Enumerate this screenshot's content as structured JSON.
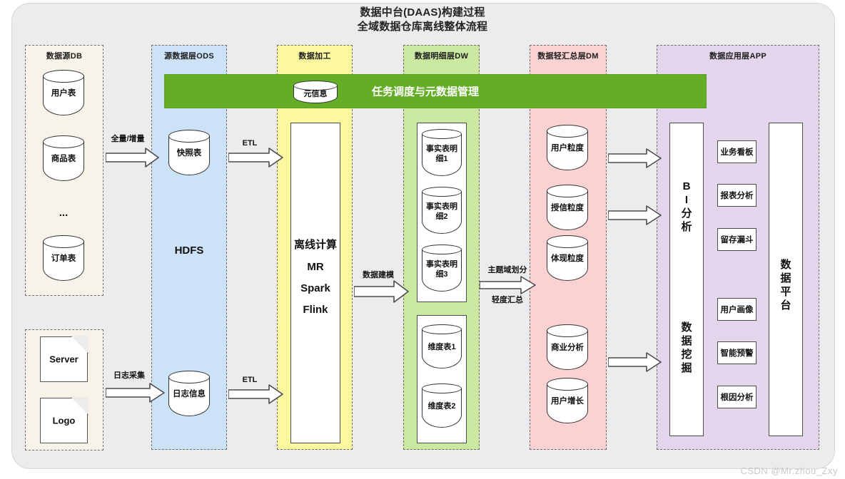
{
  "title": {
    "line1": "数据中台(DAAS)构建过程",
    "line2": "全域数据仓库离线整体流程"
  },
  "watermark": "CSDN @Mr.zhou_Zxy",
  "lanes": [
    {
      "id": "db",
      "label": "数据源DB",
      "color": "#f7f3e8"
    },
    {
      "id": "ods",
      "label": "源数据层ODS",
      "color": "#cce2f7"
    },
    {
      "id": "etl",
      "label": "数据加工",
      "color": "#fbf8a0"
    },
    {
      "id": "dw",
      "label": "数据明细层DW",
      "color": "#cbe8a0"
    },
    {
      "id": "dm",
      "label": "数据轻汇总层DM",
      "color": "#fbd2d2"
    },
    {
      "id": "app",
      "label": "数据应用层APP",
      "color": "#e2d5ec"
    }
  ],
  "green_band": {
    "cylinder_label": "元信息",
    "band_label": "任务调度与元数据管理",
    "color": "#64ad27"
  },
  "source_db": {
    "tables": [
      "用户表",
      "商品表",
      "订单表"
    ],
    "ellipsis": "..."
  },
  "log_sources": {
    "docs": [
      "Server",
      "Logo"
    ]
  },
  "ods": {
    "snapshot_table": "快照表",
    "log_info_table": "日志信息",
    "storage_label": "HDFS"
  },
  "processing": {
    "heading": "离线计算",
    "engines": [
      "MR",
      "Spark",
      "Flink"
    ]
  },
  "dw": {
    "fact_tables": [
      "事实表明\n细1",
      "事实表明\n细2",
      "事实表明\n细3"
    ],
    "dim_tables": [
      "维度表1",
      "维度表2"
    ]
  },
  "dm": {
    "granularity": [
      "用户粒度",
      "授信粒度",
      "体现粒度"
    ],
    "analysis": [
      "商业分析",
      "用户增长"
    ]
  },
  "app": {
    "left_column": [
      "BI\n分\n析",
      "数\n据\n挖\n掘"
    ],
    "bi_label": [
      "B",
      "I",
      "分",
      "析"
    ],
    "mining_label": [
      "数",
      "据",
      "挖",
      "掘"
    ],
    "platform_label": [
      "数",
      "据",
      "平",
      "台"
    ],
    "cards_top": [
      "业务看板",
      "报表分析",
      "留存漏斗"
    ],
    "cards_bottom": [
      "用户画像",
      "智能预警",
      "根因分析"
    ]
  },
  "arrows": {
    "full_incremental": "全量/增量",
    "log_collect": "日志采集",
    "etl_top": "ETL",
    "etl_bottom": "ETL",
    "data_modeling": "数据建模",
    "subject_domain": "主题域划分",
    "light_summary": "轻度汇总"
  }
}
